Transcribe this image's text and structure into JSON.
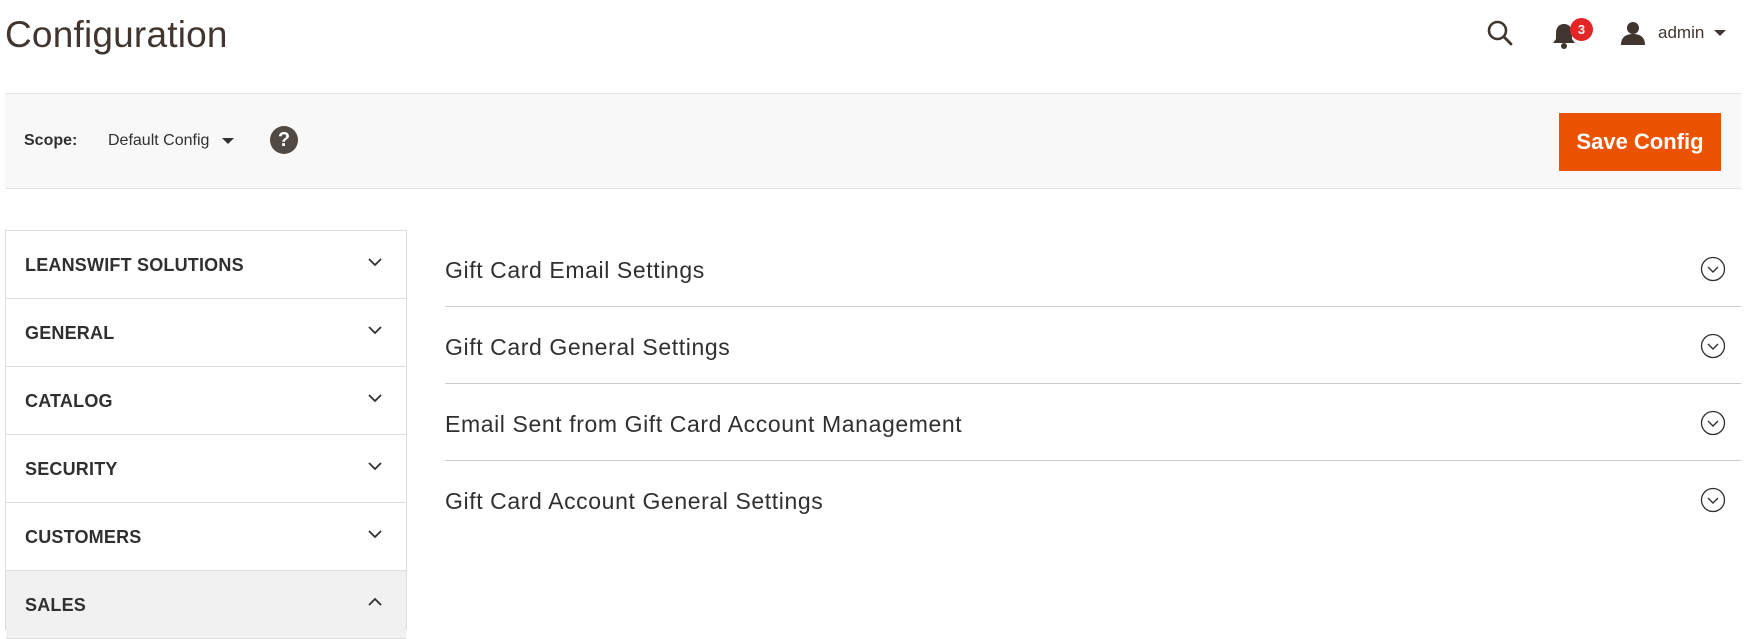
{
  "header": {
    "title": "Configuration",
    "notification_count": "3",
    "user": "admin"
  },
  "scope_bar": {
    "scope_label": "Scope:",
    "scope_value": "Default Config",
    "save_label": "Save Config"
  },
  "sidebar": {
    "items": [
      {
        "label": "LEANSWIFT SOLUTIONS",
        "expanded": false
      },
      {
        "label": "GENERAL",
        "expanded": false
      },
      {
        "label": "CATALOG",
        "expanded": false
      },
      {
        "label": "SECURITY",
        "expanded": false
      },
      {
        "label": "CUSTOMERS",
        "expanded": false
      },
      {
        "label": "SALES",
        "expanded": true
      }
    ]
  },
  "sections": [
    {
      "title": "Gift Card Email Settings"
    },
    {
      "title": "Gift Card General Settings"
    },
    {
      "title": "Email Sent from Gift Card Account Management"
    },
    {
      "title": "Gift Card Account General Settings"
    }
  ],
  "colors": {
    "accent": "#eb5202",
    "badge": "#e22626",
    "text": "#303030",
    "title": "#41362f"
  }
}
